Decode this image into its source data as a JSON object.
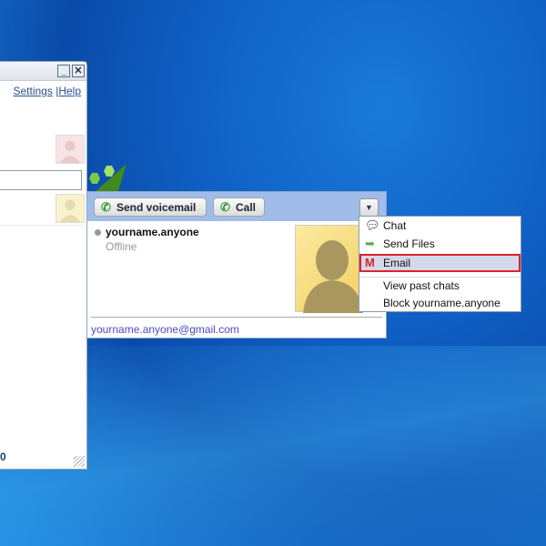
{
  "contacts_window": {
    "minimize_label": "_",
    "close_label": "✕",
    "settings_link": "Settings",
    "separator": "|",
    "help_link": "Help",
    "footer_text": "0"
  },
  "contact_card": {
    "send_voicemail_label": "Send voicemail",
    "call_label": "Call",
    "dropdown_label": "▼",
    "contact_name": "yourname.anyone",
    "status": "Offline",
    "email": "yourname.anyone@gmail.com"
  },
  "menu": {
    "items": [
      {
        "label": "Chat",
        "icon": "speech-bubble-icon"
      },
      {
        "label": "Send Files",
        "icon": "send-files-icon"
      },
      {
        "label": "Email",
        "icon": "gmail-icon",
        "selected": true
      },
      {
        "label": "View past chats"
      },
      {
        "label": "Block yourname.anyone"
      }
    ]
  },
  "colors": {
    "highlight_border": "#e0202a",
    "header": "#a0bce8",
    "email_link": "#4b4bc0"
  }
}
